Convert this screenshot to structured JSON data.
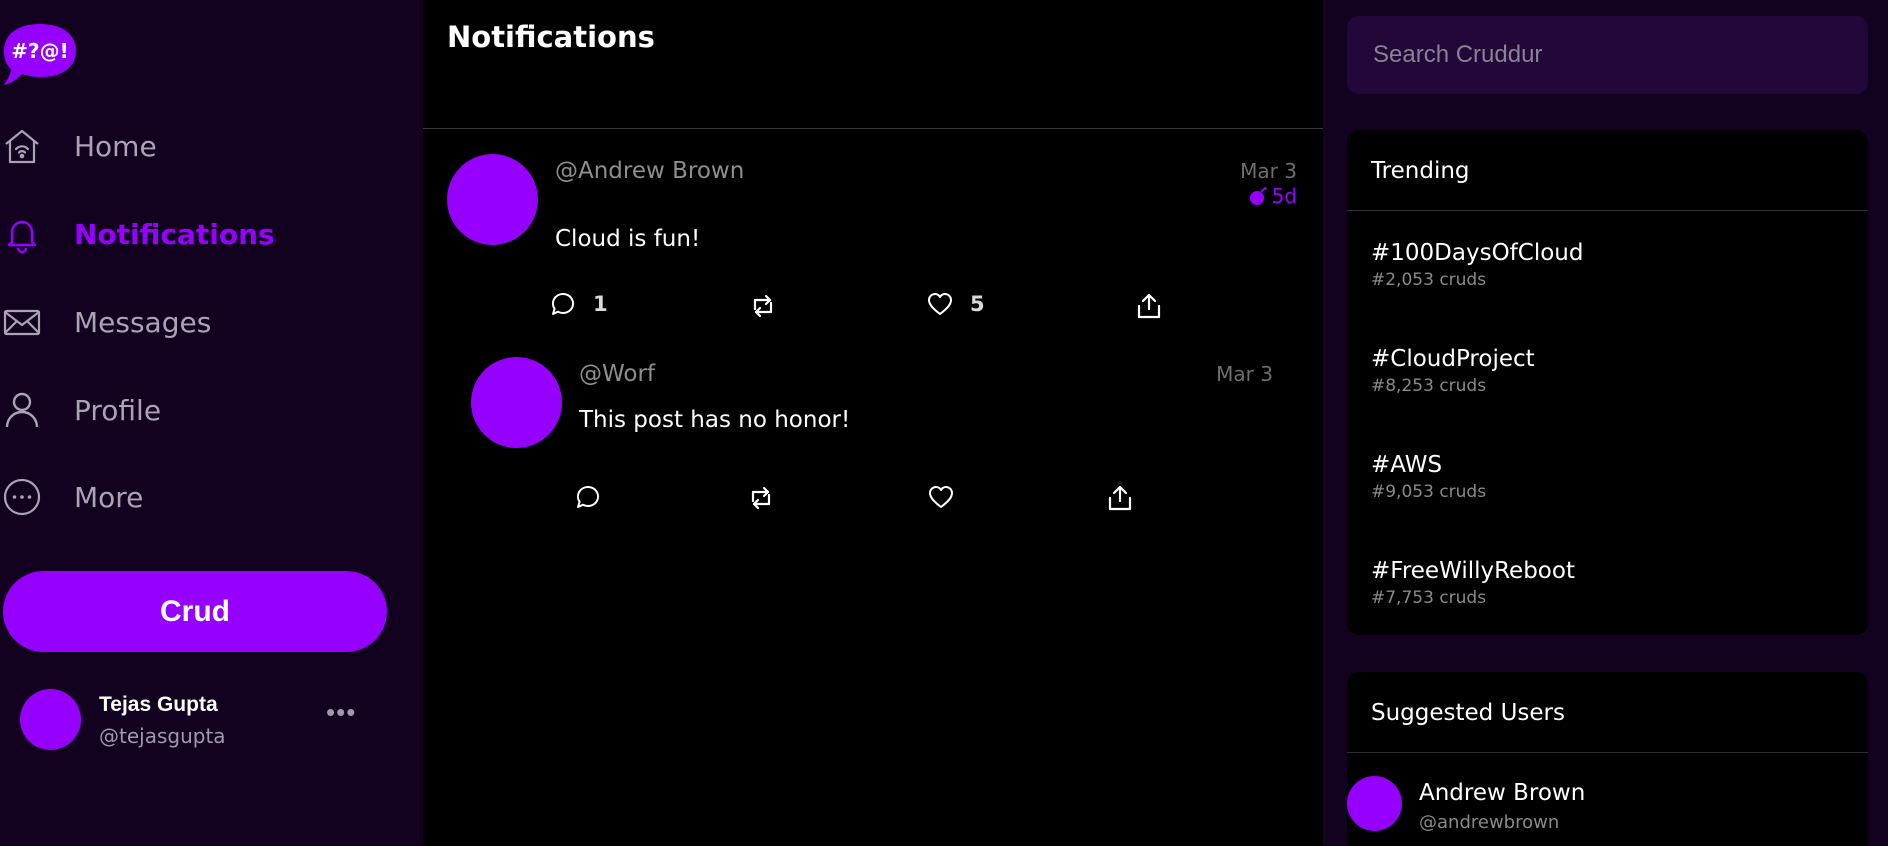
{
  "app": {
    "logo_text": "#?@!",
    "brand_color": "#9500ff"
  },
  "sidebar": {
    "nav": [
      {
        "label": "Home",
        "icon": "home-icon"
      },
      {
        "label": "Notifications",
        "icon": "bell-icon",
        "active": true
      },
      {
        "label": "Messages",
        "icon": "envelope-icon"
      },
      {
        "label": "Profile",
        "icon": "person-icon"
      },
      {
        "label": "More",
        "icon": "more-circle-icon"
      }
    ],
    "crud_button": "Crud",
    "user": {
      "name": "Tejas Gupta",
      "handle": "@tejasgupta",
      "more": "•••"
    }
  },
  "main": {
    "title": "Notifications",
    "posts": [
      {
        "handle": "@Andrew Brown",
        "date": "Mar 3",
        "expires": "5d",
        "text": "Cloud is fun!",
        "replies": "1",
        "likes": "5"
      },
      {
        "handle": "@Worf",
        "date": "Mar 3",
        "text": "This post has no honor!"
      }
    ]
  },
  "right": {
    "search_placeholder": "Search Cruddur",
    "trending": {
      "title": "Trending",
      "items": [
        {
          "tag": "#100DaysOfCloud",
          "count": "#2,053 cruds"
        },
        {
          "tag": "#CloudProject",
          "count": "#8,253 cruds"
        },
        {
          "tag": "#AWS",
          "count": "#9,053 cruds"
        },
        {
          "tag": "#FreeWillyReboot",
          "count": "#7,753 cruds"
        }
      ]
    },
    "suggested": {
      "title": "Suggested Users",
      "users": [
        {
          "name": "Andrew Brown",
          "handle": "@andrewbrown"
        }
      ]
    }
  }
}
